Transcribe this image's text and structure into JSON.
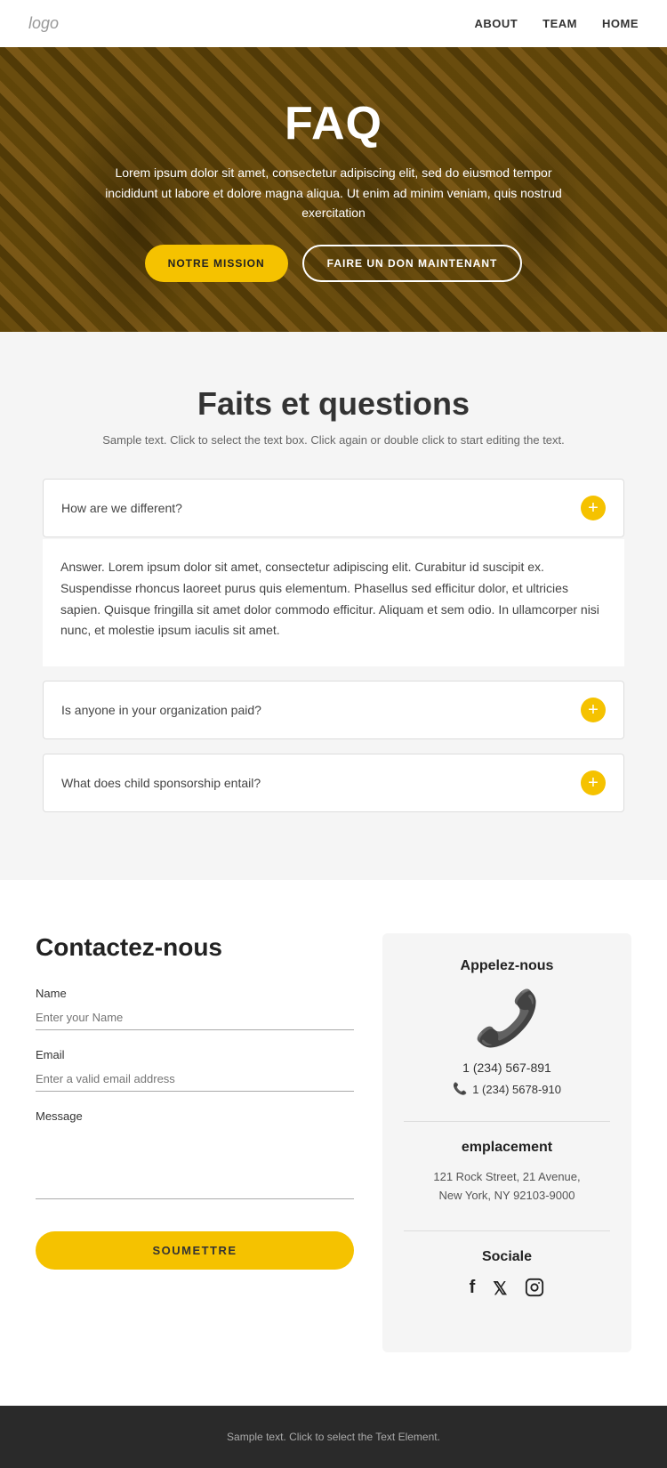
{
  "nav": {
    "logo": "logo",
    "links": [
      {
        "label": "ABOUT",
        "href": "#"
      },
      {
        "label": "TEAM",
        "href": "#"
      },
      {
        "label": "HOME",
        "href": "#"
      }
    ]
  },
  "hero": {
    "title": "FAQ",
    "subtitle": "Lorem ipsum dolor sit amet, consectetur adipiscing elit, sed do eiusmod tempor incididunt ut labore et dolore magna aliqua. Ut enim ad minim veniam, quis nostrud exercitation",
    "btn_mission": "NOTRE Mission",
    "btn_don": "FAIRE UN DON MAINTENANT"
  },
  "faq": {
    "heading": "Faits et questions",
    "subtext": "Sample text. Click to select the text box. Click again or double click to start editing the text.",
    "items": [
      {
        "question": "How are we different?",
        "answer": "Answer. Lorem ipsum dolor sit amet, consectetur adipiscing elit. Curabitur id suscipit ex. Suspendisse rhoncus laoreet purus quis elementum. Phasellus sed efficitur dolor, et ultricies sapien. Quisque fringilla sit amet dolor commodo efficitur. Aliquam et sem odio. In ullamcorper nisi nunc, et molestie ipsum iaculis sit amet.",
        "open": true
      },
      {
        "question": "Is anyone in your organization paid?",
        "answer": "",
        "open": false
      },
      {
        "question": "What does child sponsorship entail?",
        "answer": "",
        "open": false
      }
    ]
  },
  "contact": {
    "heading": "Contactez-nous",
    "form": {
      "name_label": "Name",
      "name_placeholder": "Enter your Name",
      "email_label": "Email",
      "email_placeholder": "Enter a valid email address",
      "message_label": "Message",
      "message_placeholder": "",
      "submit_label": "SOUMETTRE"
    },
    "info": {
      "call_title": "Appelez-nous",
      "phone_main": "1 (234) 567-891",
      "phone_secondary": "1 (234) 5678-910",
      "location_title": "emplacement",
      "location_text": "121 Rock Street, 21 Avenue,\nNew York, NY 92103-9000",
      "social_title": "Sociale"
    }
  },
  "footer": {
    "text": "Sample text. Click to select the Text Element."
  }
}
